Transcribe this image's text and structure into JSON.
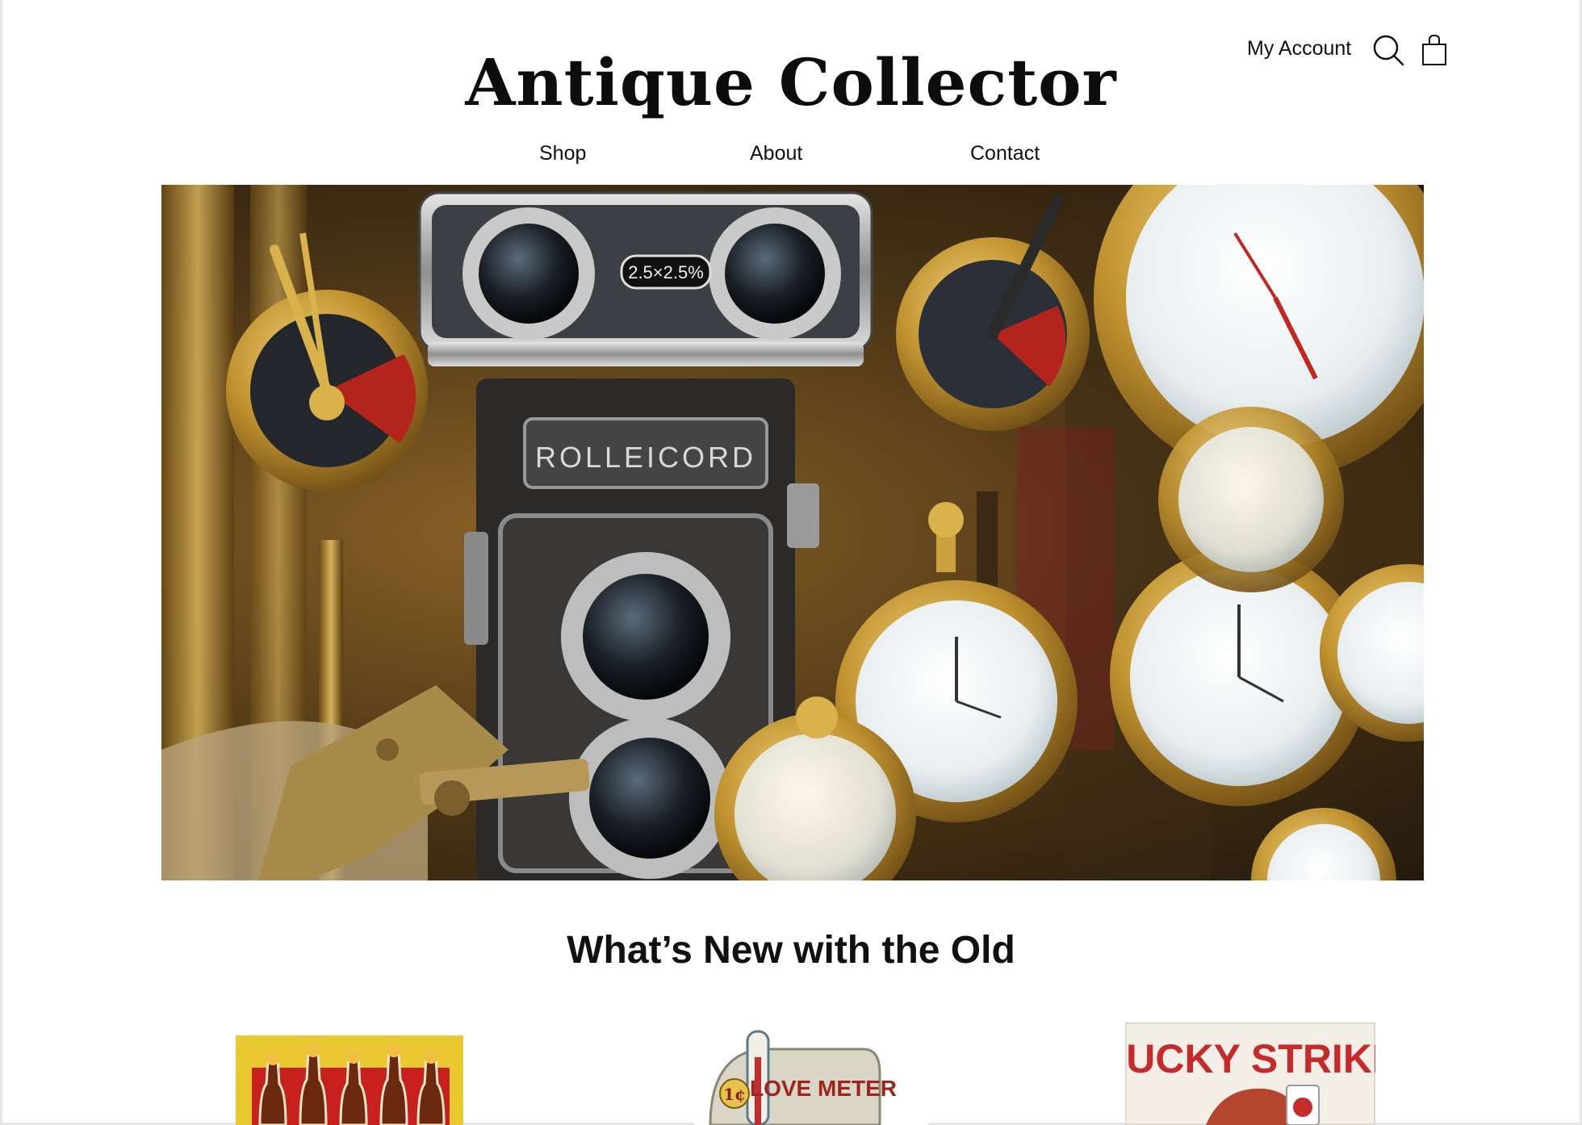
{
  "header": {
    "site_title": "Antique Collector",
    "account_label": "My Account",
    "search_icon": "search-icon",
    "cart_icon": "shopping-bag-icon"
  },
  "nav": {
    "items": [
      {
        "label": "Shop"
      },
      {
        "label": "About"
      },
      {
        "label": "Contact"
      }
    ]
  },
  "hero": {
    "camera_brand": "ROLLEICORD",
    "binocular_label": "2.5×2.5%"
  },
  "section": {
    "heading": "What’s New with the Old"
  },
  "products": [
    {
      "visible_text": ""
    },
    {
      "visible_text": "LOVE METER",
      "badge": "1¢"
    },
    {
      "visible_text": "LUCKY STRIKE"
    }
  ],
  "colors": {
    "text": "#111111",
    "brass": "#c9a13f",
    "product1_bg": "#e9c832",
    "lucky_red": "#c62a2a"
  }
}
